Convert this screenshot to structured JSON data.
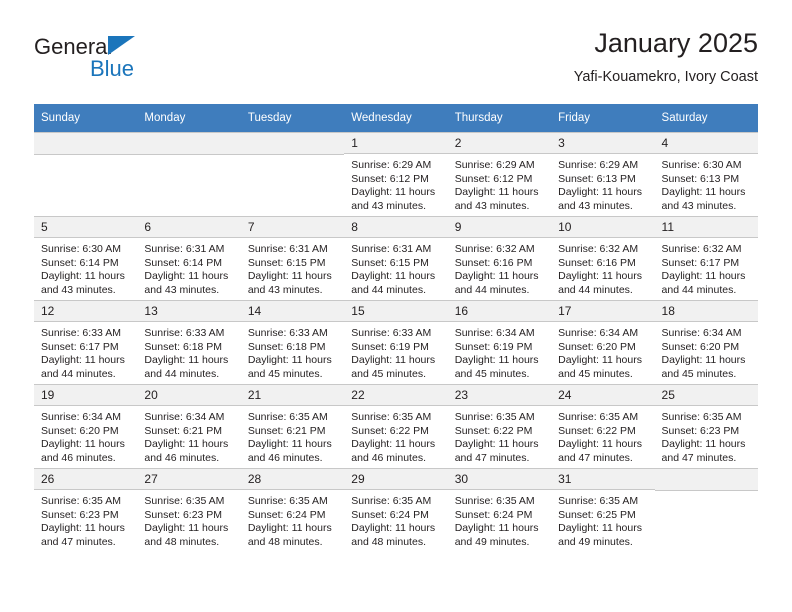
{
  "brand": {
    "line1": "General",
    "line2": "Blue",
    "accent_color": "#1b75bb"
  },
  "header": {
    "title": "January 2025",
    "location": "Yafi-Kouamekro, Ivory Coast",
    "header_bg": "#3f7dbd"
  },
  "calendar": {
    "weekday_headers": [
      "Sunday",
      "Monday",
      "Tuesday",
      "Wednesday",
      "Thursday",
      "Friday",
      "Saturday"
    ],
    "weeks": [
      [
        {
          "day": "",
          "sunrise": "",
          "sunset": "",
          "daylight_a": "",
          "daylight_b": ""
        },
        {
          "day": "",
          "sunrise": "",
          "sunset": "",
          "daylight_a": "",
          "daylight_b": ""
        },
        {
          "day": "",
          "sunrise": "",
          "sunset": "",
          "daylight_a": "",
          "daylight_b": ""
        },
        {
          "day": "1",
          "sunrise": "Sunrise: 6:29 AM",
          "sunset": "Sunset: 6:12 PM",
          "daylight_a": "Daylight: 11 hours",
          "daylight_b": "and 43 minutes."
        },
        {
          "day": "2",
          "sunrise": "Sunrise: 6:29 AM",
          "sunset": "Sunset: 6:12 PM",
          "daylight_a": "Daylight: 11 hours",
          "daylight_b": "and 43 minutes."
        },
        {
          "day": "3",
          "sunrise": "Sunrise: 6:29 AM",
          "sunset": "Sunset: 6:13 PM",
          "daylight_a": "Daylight: 11 hours",
          "daylight_b": "and 43 minutes."
        },
        {
          "day": "4",
          "sunrise": "Sunrise: 6:30 AM",
          "sunset": "Sunset: 6:13 PM",
          "daylight_a": "Daylight: 11 hours",
          "daylight_b": "and 43 minutes."
        }
      ],
      [
        {
          "day": "5",
          "sunrise": "Sunrise: 6:30 AM",
          "sunset": "Sunset: 6:14 PM",
          "daylight_a": "Daylight: 11 hours",
          "daylight_b": "and 43 minutes."
        },
        {
          "day": "6",
          "sunrise": "Sunrise: 6:31 AM",
          "sunset": "Sunset: 6:14 PM",
          "daylight_a": "Daylight: 11 hours",
          "daylight_b": "and 43 minutes."
        },
        {
          "day": "7",
          "sunrise": "Sunrise: 6:31 AM",
          "sunset": "Sunset: 6:15 PM",
          "daylight_a": "Daylight: 11 hours",
          "daylight_b": "and 43 minutes."
        },
        {
          "day": "8",
          "sunrise": "Sunrise: 6:31 AM",
          "sunset": "Sunset: 6:15 PM",
          "daylight_a": "Daylight: 11 hours",
          "daylight_b": "and 44 minutes."
        },
        {
          "day": "9",
          "sunrise": "Sunrise: 6:32 AM",
          "sunset": "Sunset: 6:16 PM",
          "daylight_a": "Daylight: 11 hours",
          "daylight_b": "and 44 minutes."
        },
        {
          "day": "10",
          "sunrise": "Sunrise: 6:32 AM",
          "sunset": "Sunset: 6:16 PM",
          "daylight_a": "Daylight: 11 hours",
          "daylight_b": "and 44 minutes."
        },
        {
          "day": "11",
          "sunrise": "Sunrise: 6:32 AM",
          "sunset": "Sunset: 6:17 PM",
          "daylight_a": "Daylight: 11 hours",
          "daylight_b": "and 44 minutes."
        }
      ],
      [
        {
          "day": "12",
          "sunrise": "Sunrise: 6:33 AM",
          "sunset": "Sunset: 6:17 PM",
          "daylight_a": "Daylight: 11 hours",
          "daylight_b": "and 44 minutes."
        },
        {
          "day": "13",
          "sunrise": "Sunrise: 6:33 AM",
          "sunset": "Sunset: 6:18 PM",
          "daylight_a": "Daylight: 11 hours",
          "daylight_b": "and 44 minutes."
        },
        {
          "day": "14",
          "sunrise": "Sunrise: 6:33 AM",
          "sunset": "Sunset: 6:18 PM",
          "daylight_a": "Daylight: 11 hours",
          "daylight_b": "and 45 minutes."
        },
        {
          "day": "15",
          "sunrise": "Sunrise: 6:33 AM",
          "sunset": "Sunset: 6:19 PM",
          "daylight_a": "Daylight: 11 hours",
          "daylight_b": "and 45 minutes."
        },
        {
          "day": "16",
          "sunrise": "Sunrise: 6:34 AM",
          "sunset": "Sunset: 6:19 PM",
          "daylight_a": "Daylight: 11 hours",
          "daylight_b": "and 45 minutes."
        },
        {
          "day": "17",
          "sunrise": "Sunrise: 6:34 AM",
          "sunset": "Sunset: 6:20 PM",
          "daylight_a": "Daylight: 11 hours",
          "daylight_b": "and 45 minutes."
        },
        {
          "day": "18",
          "sunrise": "Sunrise: 6:34 AM",
          "sunset": "Sunset: 6:20 PM",
          "daylight_a": "Daylight: 11 hours",
          "daylight_b": "and 45 minutes."
        }
      ],
      [
        {
          "day": "19",
          "sunrise": "Sunrise: 6:34 AM",
          "sunset": "Sunset: 6:20 PM",
          "daylight_a": "Daylight: 11 hours",
          "daylight_b": "and 46 minutes."
        },
        {
          "day": "20",
          "sunrise": "Sunrise: 6:34 AM",
          "sunset": "Sunset: 6:21 PM",
          "daylight_a": "Daylight: 11 hours",
          "daylight_b": "and 46 minutes."
        },
        {
          "day": "21",
          "sunrise": "Sunrise: 6:35 AM",
          "sunset": "Sunset: 6:21 PM",
          "daylight_a": "Daylight: 11 hours",
          "daylight_b": "and 46 minutes."
        },
        {
          "day": "22",
          "sunrise": "Sunrise: 6:35 AM",
          "sunset": "Sunset: 6:22 PM",
          "daylight_a": "Daylight: 11 hours",
          "daylight_b": "and 46 minutes."
        },
        {
          "day": "23",
          "sunrise": "Sunrise: 6:35 AM",
          "sunset": "Sunset: 6:22 PM",
          "daylight_a": "Daylight: 11 hours",
          "daylight_b": "and 47 minutes."
        },
        {
          "day": "24",
          "sunrise": "Sunrise: 6:35 AM",
          "sunset": "Sunset: 6:22 PM",
          "daylight_a": "Daylight: 11 hours",
          "daylight_b": "and 47 minutes."
        },
        {
          "day": "25",
          "sunrise": "Sunrise: 6:35 AM",
          "sunset": "Sunset: 6:23 PM",
          "daylight_a": "Daylight: 11 hours",
          "daylight_b": "and 47 minutes."
        }
      ],
      [
        {
          "day": "26",
          "sunrise": "Sunrise: 6:35 AM",
          "sunset": "Sunset: 6:23 PM",
          "daylight_a": "Daylight: 11 hours",
          "daylight_b": "and 47 minutes."
        },
        {
          "day": "27",
          "sunrise": "Sunrise: 6:35 AM",
          "sunset": "Sunset: 6:23 PM",
          "daylight_a": "Daylight: 11 hours",
          "daylight_b": "and 48 minutes."
        },
        {
          "day": "28",
          "sunrise": "Sunrise: 6:35 AM",
          "sunset": "Sunset: 6:24 PM",
          "daylight_a": "Daylight: 11 hours",
          "daylight_b": "and 48 minutes."
        },
        {
          "day": "29",
          "sunrise": "Sunrise: 6:35 AM",
          "sunset": "Sunset: 6:24 PM",
          "daylight_a": "Daylight: 11 hours",
          "daylight_b": "and 48 minutes."
        },
        {
          "day": "30",
          "sunrise": "Sunrise: 6:35 AM",
          "sunset": "Sunset: 6:24 PM",
          "daylight_a": "Daylight: 11 hours",
          "daylight_b": "and 49 minutes."
        },
        {
          "day": "31",
          "sunrise": "Sunrise: 6:35 AM",
          "sunset": "Sunset: 6:25 PM",
          "daylight_a": "Daylight: 11 hours",
          "daylight_b": "and 49 minutes."
        },
        {
          "day": "",
          "sunrise": "",
          "sunset": "",
          "daylight_a": "",
          "daylight_b": ""
        }
      ]
    ]
  }
}
